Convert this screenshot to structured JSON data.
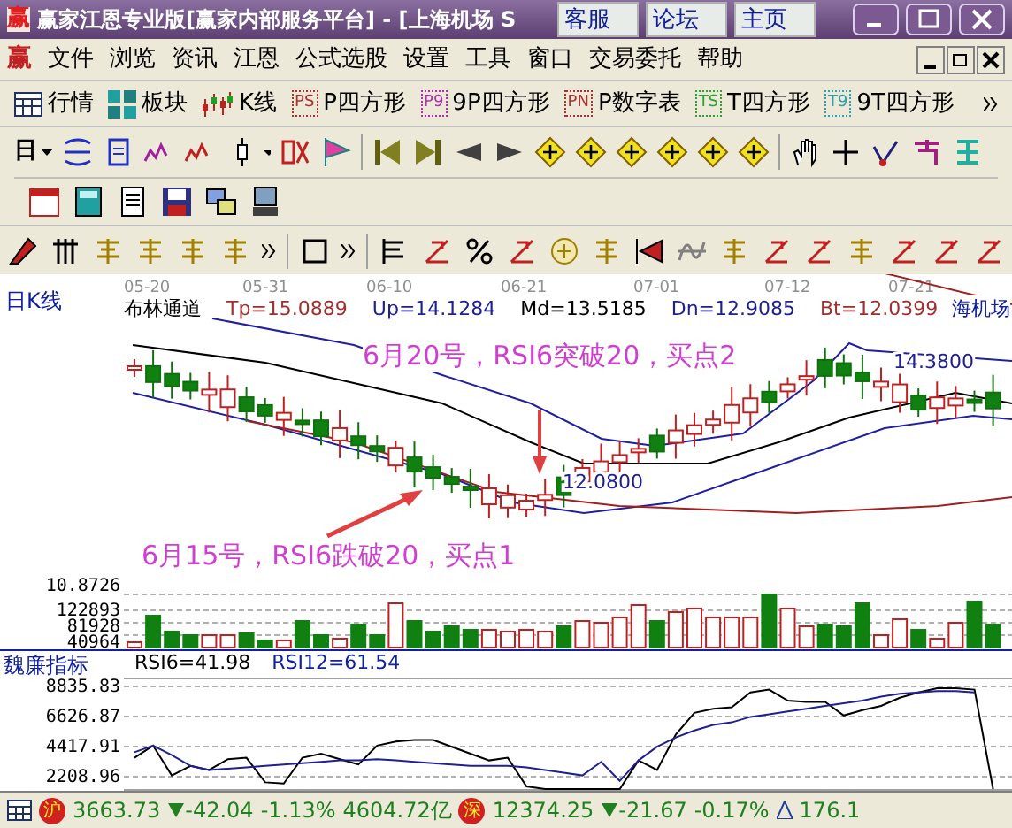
{
  "window": {
    "app_icon": "赢",
    "title": "赢家江恩专业版[赢家内部服务平台] - [上海机场 S",
    "links": [
      "客服",
      "论坛",
      "主页"
    ]
  },
  "menu": {
    "app_icon": "赢",
    "items": [
      "文件",
      "浏览",
      "资讯",
      "江恩",
      "公式选股",
      "设置",
      "工具",
      "窗口",
      "交易委托",
      "帮助"
    ]
  },
  "quick_bar": [
    {
      "label": "行情",
      "kind": "table"
    },
    {
      "label": "板块",
      "kind": "blocks"
    },
    {
      "label": "K线",
      "kind": "candles"
    },
    {
      "label": "P四方形",
      "kind": "tag",
      "tag": "PS",
      "color": "#b03030"
    },
    {
      "label": "9P四方形",
      "kind": "tag",
      "tag": "P9",
      "color": "#b030b0"
    },
    {
      "label": "P数字表",
      "kind": "tag",
      "tag": "PN",
      "color": "#b03030"
    },
    {
      "label": "T四方形",
      "kind": "tag",
      "tag": "TS",
      "color": "#30a030"
    },
    {
      "label": "9T四方形",
      "kind": "tag",
      "tag": "T9",
      "color": "#30a0b0"
    }
  ],
  "period": "日",
  "chart": {
    "title": "日K线",
    "dates": [
      "05-20",
      "05-31",
      "06-10",
      "06-21",
      "07-01",
      "07-12",
      "07-21"
    ],
    "indicator": "布林通道",
    "values": [
      {
        "text": "Tp=15.0889",
        "color": "#a03030"
      },
      {
        "text": "Up=14.1284",
        "color": "#202090"
      },
      {
        "text": "Md=13.5185",
        "color": "#000000"
      },
      {
        "text": "Dn=12.9085",
        "color": "#202090"
      },
      {
        "text": "Bt=12.0399",
        "color": "#a03030"
      }
    ],
    "stock": "海机场",
    "high_label": "14.3800",
    "low_label": "12.0800",
    "annotations": [
      "6月20号，RSI6突破20，买点2",
      "6月15号，RSI6跌破20，买点1"
    ]
  },
  "volume": {
    "ticks": [
      "10.8726",
      "122893",
      "81928",
      "40964"
    ]
  },
  "rsi": {
    "title": "魏廉指标",
    "values": [
      "RSI6=41.98",
      "RSI12=61.54"
    ],
    "chart_data": {
      "type": "line",
      "yticks": [
        {
          "value": 8835.83,
          "label": "8835.83"
        },
        {
          "value": 6626.87,
          "label": "6626.87"
        },
        {
          "value": 4417.91,
          "label": "4417.91"
        },
        {
          "value": 2208.96,
          "label": "2208.96"
        }
      ],
      "ylim": [
        1170,
        9485
      ],
      "grid": true,
      "series": [
        {
          "color": "#000000",
          "values": [
            3600,
            4500,
            2300,
            3000,
            2700,
            3500,
            3600,
            1800,
            1700,
            3600,
            3900,
            3500,
            3100,
            4500,
            4800,
            4900,
            4900,
            4400,
            3900,
            3400,
            3600,
            1500,
            1300,
            1300,
            1300,
            1300,
            1300,
            3400,
            2700,
            5300,
            6900,
            7200,
            7300,
            8400,
            8600,
            7800,
            7700,
            7700,
            6700,
            7100,
            7400,
            8000,
            8400,
            8700,
            8700,
            8600,
            1300
          ]
        },
        {
          "color": "#202090",
          "values": [
            4000,
            4500,
            3800,
            3000,
            2700,
            2800,
            2900,
            3000,
            3100,
            3200,
            3300,
            3400,
            3400,
            3500,
            3400,
            3300,
            3200,
            3100,
            3000,
            3000,
            3000,
            2900,
            2700,
            2500,
            2300,
            3300,
            1900,
            3400,
            4400,
            5100,
            5600,
            6000,
            6200,
            6600,
            6800,
            7000,
            7200,
            7400,
            7600,
            7800,
            8100,
            8300,
            8400,
            8500,
            8500,
            8400,
            null
          ]
        }
      ]
    }
  },
  "status": {
    "sh_badge": "沪",
    "sh": [
      "3663.73",
      "-42.04",
      "-1.13%",
      "4604.72亿"
    ],
    "sz_badge": "深",
    "sz": [
      "12374.25",
      "-21.67",
      "-0.17%"
    ],
    "extra": "176.1"
  }
}
